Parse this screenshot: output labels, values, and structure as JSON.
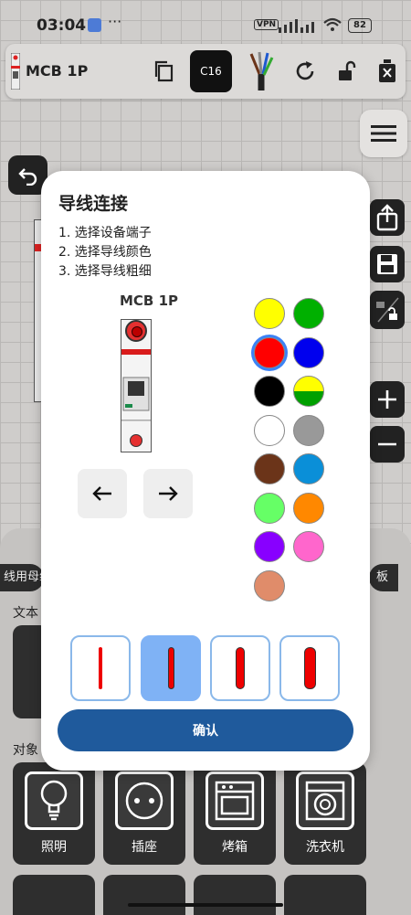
{
  "status_bar": {
    "time": "03:04",
    "dots": "···",
    "vpn": "VPN",
    "battery": "82"
  },
  "toolbar": {
    "title": "MCB 1P",
    "badge": "C16"
  },
  "bottom_sheet": {
    "chip_left": "线用母线",
    "chip_right": "板",
    "text_section": "文本",
    "object_section": "对象",
    "objects": [
      {
        "label": "照明",
        "icon": "bulb-icon"
      },
      {
        "label": "插座",
        "icon": "socket-icon"
      },
      {
        "label": "烤箱",
        "icon": "oven-icon"
      },
      {
        "label": "洗衣机",
        "icon": "washing-machine-icon"
      }
    ]
  },
  "dialog": {
    "title": "导线连接",
    "steps": [
      "1. 选择设备端子",
      "2. 选择导线颜色",
      "3. 选择导线粗细"
    ],
    "device_name": "MCB 1P",
    "confirm": "确认",
    "colors": [
      {
        "name": "yellow",
        "hex": "#ffff00"
      },
      {
        "name": "green",
        "hex": "#00b000"
      },
      {
        "name": "red",
        "hex": "#ff0000",
        "selected": true
      },
      {
        "name": "blue",
        "hex": "#0000ee"
      },
      {
        "name": "black",
        "hex": "#000000"
      },
      {
        "name": "yellow-green",
        "hex": "#ffff00"
      },
      {
        "name": "white",
        "hex": "#ffffff"
      },
      {
        "name": "grey",
        "hex": "#999999"
      },
      {
        "name": "brown",
        "hex": "#6b3419"
      },
      {
        "name": "light-blue",
        "hex": "#0a8fd8"
      },
      {
        "name": "light-green",
        "hex": "#66ff66"
      },
      {
        "name": "orange",
        "hex": "#ff8800"
      },
      {
        "name": "purple",
        "hex": "#8800ff"
      },
      {
        "name": "pink",
        "hex": "#ff66cc"
      },
      {
        "name": "salmon",
        "hex": "#e08c6a"
      }
    ],
    "thickness_options": [
      {
        "size": 1,
        "selected": false
      },
      {
        "size": 2,
        "selected": true
      },
      {
        "size": 3,
        "selected": false
      },
      {
        "size": 4,
        "selected": false
      }
    ]
  }
}
